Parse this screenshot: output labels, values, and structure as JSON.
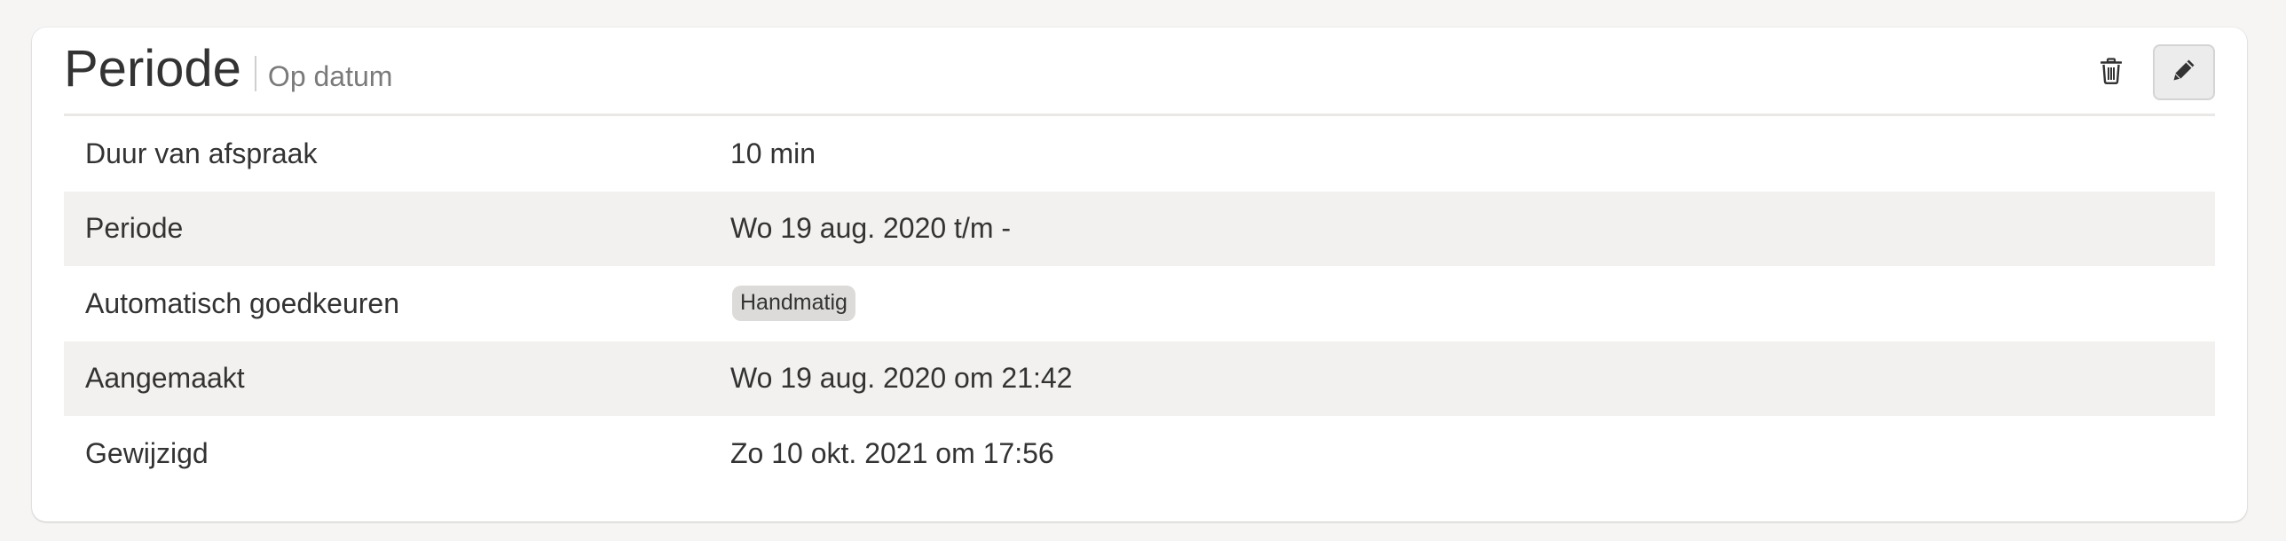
{
  "card": {
    "title": "Periode",
    "subtitle": "Op datum",
    "actions": {
      "delete_icon": "trash-icon",
      "edit_icon": "pencil-icon"
    }
  },
  "details": [
    {
      "label": "Duur van afspraak",
      "value": "10 min"
    },
    {
      "label": "Periode",
      "value": "Wo 19 aug. 2020 t/m -"
    },
    {
      "label": "Automatisch goedkeuren",
      "badge": "Handmatig"
    },
    {
      "label": "Aangemaakt",
      "value": "Wo 19 aug. 2020 om 21:42"
    },
    {
      "label": "Gewijzigd",
      "value": "Zo 10 okt. 2021 om 17:56"
    }
  ],
  "colors": {
    "page_bg": "#f6f5f4",
    "card_bg": "#ffffff",
    "row_stripe": "#f2f1ef",
    "badge_bg": "#dcdbd9",
    "text": "#333333",
    "muted_text": "#7a7a7a"
  }
}
